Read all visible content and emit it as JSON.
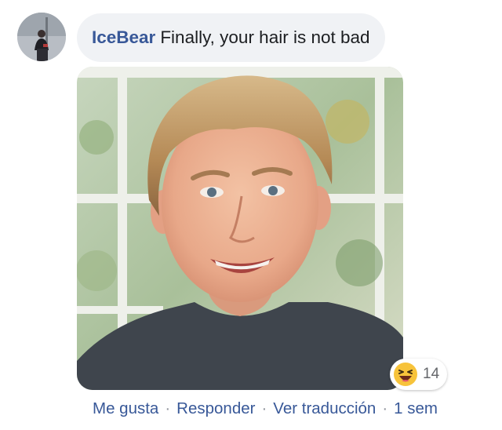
{
  "comment": {
    "author": "IceBear",
    "text": "Finally, your hair is not bad"
  },
  "reaction": {
    "icon": "haha-emoji-icon",
    "count": "14"
  },
  "actions": {
    "like_label": "Me gusta",
    "reply_label": "Responder",
    "translate_label": "Ver traducción",
    "separator": "·",
    "timestamp": "1 sem"
  },
  "colors": {
    "author_link": "#385898",
    "bubble_bg": "#f0f2f5",
    "meta_separator": "#90949c"
  }
}
